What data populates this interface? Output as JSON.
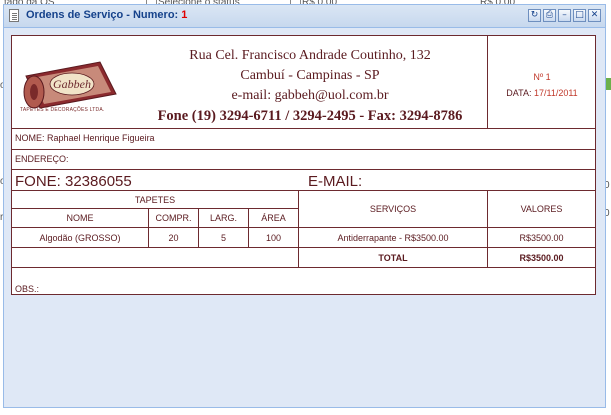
{
  "background": {
    "fragments": [
      "tado da OS",
      "Selecione o status",
      "R$ 0,00",
      "R$ 0,00"
    ],
    "left_letters": [
      "o",
      "o",
      "r"
    ],
    "right_letters": [
      "0",
      "0"
    ],
    "accent_color": "#6bb04a"
  },
  "window": {
    "title_prefix": "Ordens de Serviço - Numero:",
    "title_number": "1",
    "tools": [
      "refresh-icon",
      "print-icon",
      "minimize-icon",
      "maximize-icon",
      "close-icon"
    ]
  },
  "company": {
    "logo_name": "Gabbeh",
    "logo_caption": "TAPETES E DECORAÇÕES LTDA.",
    "address_line": "Rua Cel. Francisco Andrade Coutinho, 132",
    "city_line": "Cambuí - Campinas - SP",
    "email_line": "e-mail: gabbeh@uol.com.br",
    "phone_line": "Fone (19) 3294-6711 / 3294-2495 - Fax: 3294-8786"
  },
  "order": {
    "number_label": "Nº 1",
    "date_label": "DATA:",
    "date_value": "17/11/2011"
  },
  "client": {
    "name_line": "NOME: Raphael Henrique Figueira",
    "address_line": "ENDEREÇO:",
    "phone_line": "FONE: 32386055",
    "email_line": "E-MAIL:"
  },
  "table": {
    "tapetes_header": "TAPETES",
    "servicos_header": "SERVIÇOS",
    "valores_header": "VALORES",
    "columns": [
      "NOME",
      "COMPR.",
      "LARG.",
      "ÁREA"
    ],
    "rows": [
      {
        "nome": "Algodão (GROSSO)",
        "compr": "20",
        "larg": "5",
        "area": "100",
        "servico": "Antiderrapante - R$3500.00",
        "valor": "R$3500.00"
      }
    ],
    "total_label": "TOTAL",
    "total_value": "R$3500.00"
  },
  "obs_label": "OBS.:",
  "colors": {
    "frame_border": "#99bbe8",
    "title_color": "#15428b",
    "doc_text": "#5a1a1f",
    "highlight_red": "#c0392b"
  }
}
